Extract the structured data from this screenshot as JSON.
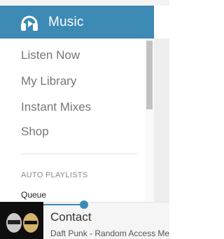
{
  "colors": {
    "accent": "#3d8ab4",
    "nav_text": "#777777",
    "heading_text": "#888888"
  },
  "header": {
    "icon": "headphones-icon",
    "title": "Music"
  },
  "nav": {
    "items": [
      {
        "label": "Listen Now"
      },
      {
        "label": "My Library"
      },
      {
        "label": "Instant Mixes"
      },
      {
        "label": "Shop"
      }
    ]
  },
  "playlists": {
    "heading": "AUTO PLAYLISTS",
    "items": [
      {
        "label": "Queue"
      }
    ]
  },
  "player": {
    "album_art_icon": "album-art",
    "track_title": "Contact",
    "track_artist": "Daft Punk - Random Access Memories",
    "progress": 0.32
  }
}
